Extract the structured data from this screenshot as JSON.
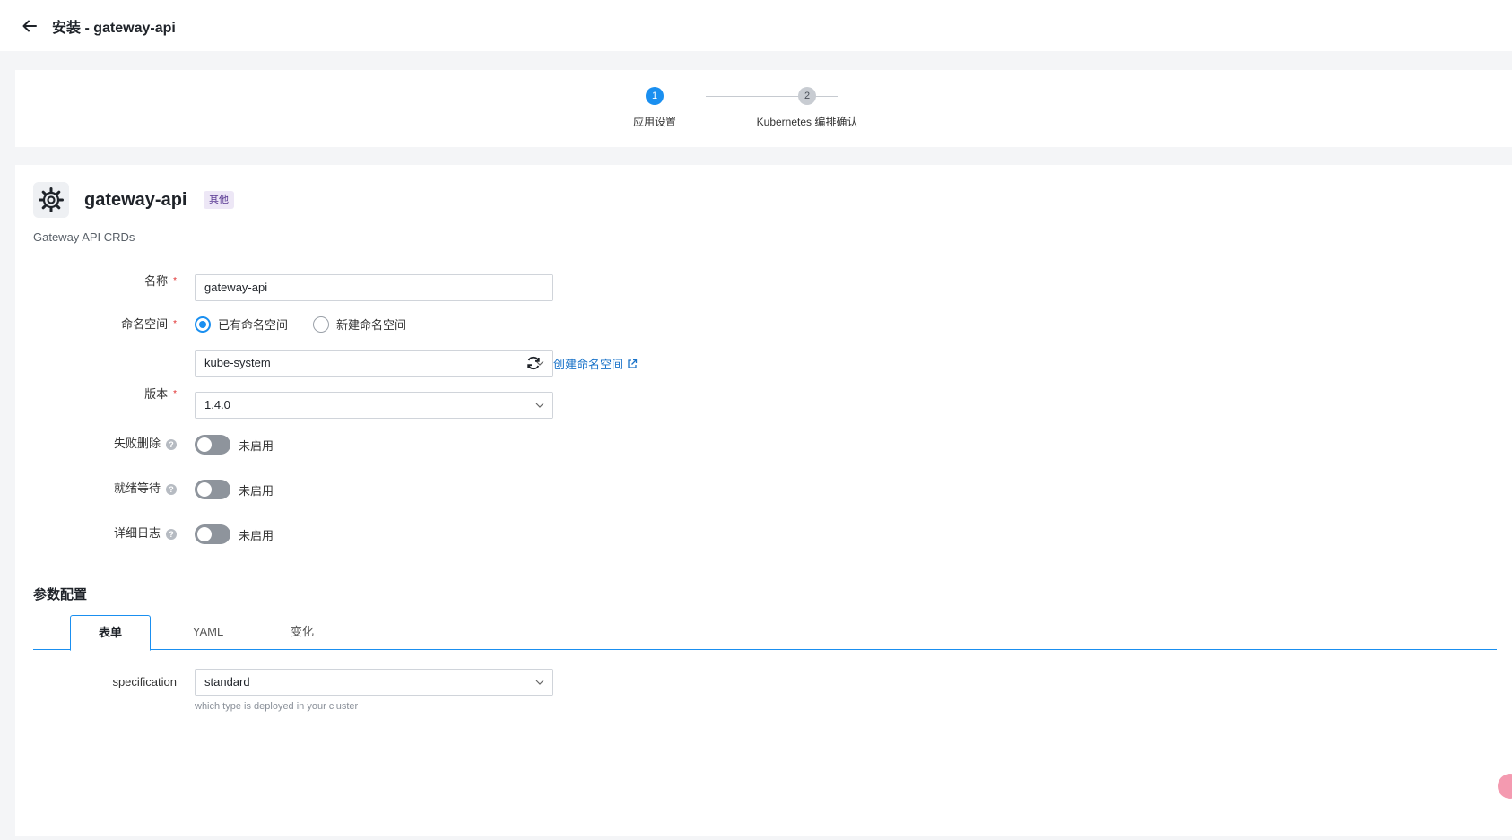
{
  "header": {
    "title": "安装 - gateway-api"
  },
  "steps": [
    {
      "number": "1",
      "label": "应用设置"
    },
    {
      "number": "2",
      "label": "Kubernetes 编排确认"
    }
  ],
  "app": {
    "name": "gateway-api",
    "tag": "其他",
    "description": "Gateway API CRDs"
  },
  "form": {
    "name": {
      "label": "名称",
      "value": "gateway-api"
    },
    "namespace": {
      "label": "命名空间",
      "options": [
        "已有命名空间",
        "新建命名空间"
      ],
      "selected": "kube-system",
      "create_link": "创建命名空间"
    },
    "version": {
      "label": "版本",
      "value": "1.4.0"
    },
    "toggles": [
      {
        "label": "失败删除",
        "state": "未启用"
      },
      {
        "label": "就绪等待",
        "state": "未启用"
      },
      {
        "label": "详细日志",
        "state": "未启用"
      }
    ]
  },
  "params": {
    "title": "参数配置",
    "tabs": [
      "表单",
      "YAML",
      "变化"
    ],
    "specification": {
      "label": "specification",
      "value": "standard",
      "hint": "which type is deployed in your cluster"
    }
  },
  "colors": {
    "accent": "#1a8ff0",
    "tag_bg": "#ede7f6",
    "link": "#1a73c9"
  }
}
